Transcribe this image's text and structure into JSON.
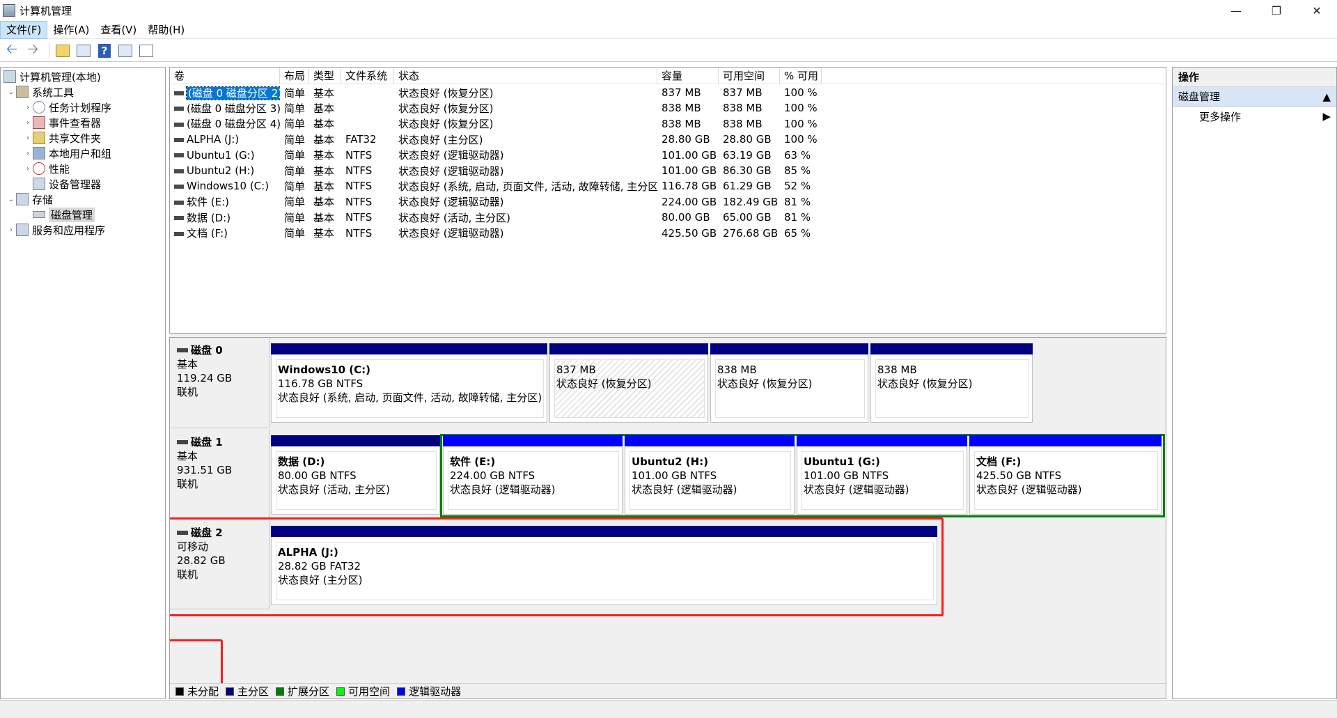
{
  "window": {
    "title": "计算机管理",
    "min": "—",
    "max": "❐",
    "close": "✕"
  },
  "menu": [
    "文件(F)",
    "操作(A)",
    "查看(V)",
    "帮助(H)"
  ],
  "tree": {
    "root": "计算机管理(本地)",
    "system_tools": "系统工具",
    "task_scheduler": "任务计划程序",
    "event_viewer": "事件查看器",
    "shared_folders": "共享文件夹",
    "local_users": "本地用户和组",
    "performance": "性能",
    "device_manager": "设备管理器",
    "storage": "存储",
    "disk_management": "磁盘管理",
    "services": "服务和应用程序"
  },
  "volume_headers": [
    "卷",
    "布局",
    "类型",
    "文件系统",
    "状态",
    "容量",
    "可用空间",
    "% 可用"
  ],
  "volumes": [
    {
      "name": "(磁盘 0 磁盘分区 2)",
      "layout": "简单",
      "type": "基本",
      "fs": "",
      "status": "状态良好 (恢复分区)",
      "capacity": "837 MB",
      "free": "837 MB",
      "pct": "100 %"
    },
    {
      "name": "(磁盘 0 磁盘分区 3)",
      "layout": "简单",
      "type": "基本",
      "fs": "",
      "status": "状态良好 (恢复分区)",
      "capacity": "838 MB",
      "free": "838 MB",
      "pct": "100 %"
    },
    {
      "name": "(磁盘 0 磁盘分区 4)",
      "layout": "简单",
      "type": "基本",
      "fs": "",
      "status": "状态良好 (恢复分区)",
      "capacity": "838 MB",
      "free": "838 MB",
      "pct": "100 %"
    },
    {
      "name": "ALPHA (J:)",
      "layout": "简单",
      "type": "基本",
      "fs": "FAT32",
      "status": "状态良好 (主分区)",
      "capacity": "28.80 GB",
      "free": "28.80 GB",
      "pct": "100 %"
    },
    {
      "name": "Ubuntu1 (G:)",
      "layout": "简单",
      "type": "基本",
      "fs": "NTFS",
      "status": "状态良好 (逻辑驱动器)",
      "capacity": "101.00 GB",
      "free": "63.19 GB",
      "pct": "63 %"
    },
    {
      "name": "Ubuntu2 (H:)",
      "layout": "简单",
      "type": "基本",
      "fs": "NTFS",
      "status": "状态良好 (逻辑驱动器)",
      "capacity": "101.00 GB",
      "free": "86.30 GB",
      "pct": "85 %"
    },
    {
      "name": "Windows10 (C:)",
      "layout": "简单",
      "type": "基本",
      "fs": "NTFS",
      "status": "状态良好 (系统, 启动, 页面文件, 活动, 故障转储, 主分区)",
      "capacity": "116.78 GB",
      "free": "61.29 GB",
      "pct": "52 %"
    },
    {
      "name": "软件 (E:)",
      "layout": "简单",
      "type": "基本",
      "fs": "NTFS",
      "status": "状态良好 (逻辑驱动器)",
      "capacity": "224.00 GB",
      "free": "182.49 GB",
      "pct": "81 %"
    },
    {
      "name": "数据 (D:)",
      "layout": "简单",
      "type": "基本",
      "fs": "NTFS",
      "status": "状态良好 (活动, 主分区)",
      "capacity": "80.00 GB",
      "free": "65.00 GB",
      "pct": "81 %"
    },
    {
      "name": "文档 (F:)",
      "layout": "简单",
      "type": "基本",
      "fs": "NTFS",
      "status": "状态良好 (逻辑驱动器)",
      "capacity": "425.50 GB",
      "free": "276.68 GB",
      "pct": "65 %"
    }
  ],
  "disks": [
    {
      "name": "磁盘 0",
      "kind": "基本",
      "size": "119.24 GB",
      "state": "联机",
      "partitions": [
        {
          "title": "Windows10 (C:)",
          "line1": "116.78 GB NTFS",
          "line2": "状态良好 (系统, 启动, 页面文件, 活动, 故障转储, 主分区)"
        },
        {
          "title": "",
          "line1": "837 MB",
          "line2": "状态良好 (恢复分区)"
        },
        {
          "title": "",
          "line1": "838 MB",
          "line2": "状态良好 (恢复分区)"
        },
        {
          "title": "",
          "line1": "838 MB",
          "line2": "状态良好 (恢复分区)"
        }
      ]
    },
    {
      "name": "磁盘 1",
      "kind": "基本",
      "size": "931.51 GB",
      "state": "联机",
      "partitions": [
        {
          "title": "数据 (D:)",
          "line1": "80.00 GB NTFS",
          "line2": "状态良好 (活动, 主分区)"
        },
        {
          "title": "软件 (E:)",
          "line1": "224.00 GB NTFS",
          "line2": "状态良好 (逻辑驱动器)"
        },
        {
          "title": "Ubuntu2 (H:)",
          "line1": "101.00 GB NTFS",
          "line2": "状态良好 (逻辑驱动器)"
        },
        {
          "title": "Ubuntu1 (G:)",
          "line1": "101.00 GB NTFS",
          "line2": "状态良好 (逻辑驱动器)"
        },
        {
          "title": "文档 (F:)",
          "line1": "425.50 GB NTFS",
          "line2": "状态良好 (逻辑驱动器)"
        }
      ]
    },
    {
      "name": "磁盘 2",
      "kind": "可移动",
      "size": "28.82 GB",
      "state": "联机",
      "partitions": [
        {
          "title": "ALPHA (J:)",
          "line1": "28.82 GB FAT32",
          "line2": "状态良好 (主分区)"
        }
      ]
    }
  ],
  "legend": [
    {
      "label": "未分配",
      "color": "#000000"
    },
    {
      "label": "主分区",
      "color": "#000080"
    },
    {
      "label": "扩展分区",
      "color": "#008000"
    },
    {
      "label": "可用空间",
      "color": "#00ff00"
    },
    {
      "label": "逻辑驱动器",
      "color": "#0000ff"
    }
  ],
  "actions": {
    "title": "操作",
    "section": "磁盘管理",
    "more": "更多操作"
  },
  "colors": {
    "primary": "#000080",
    "logical": "#0000ff",
    "extended": "#008000",
    "highlight": "#ff1a1a",
    "selection": "#0078d7"
  }
}
